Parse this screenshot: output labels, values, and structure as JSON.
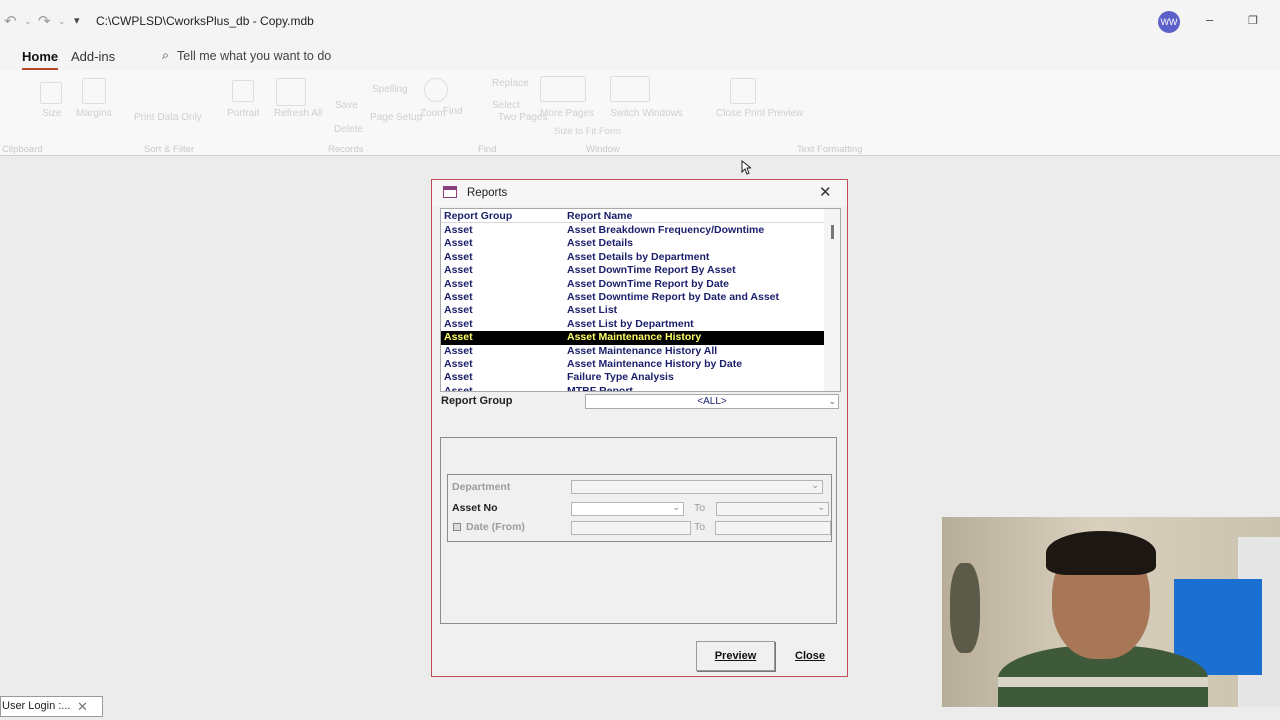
{
  "titlebar": {
    "path": "C:\\CWPLSD\\CworksPlus_db - Copy.mdb",
    "avatar_initials": "WW",
    "undo_icon": "undo-icon",
    "redo_icon": "redo-icon"
  },
  "tabs": {
    "home": "Home",
    "addins": "Add-ins",
    "tell_me": "Tell me what you want to do"
  },
  "ribbon": {
    "items": [
      "Size",
      "Margins",
      "Print Data Only",
      "Portrait",
      "Landscape",
      "Columns",
      "Page Setup",
      "Zoom",
      "One Page",
      "Two Pages",
      "More Pages",
      "Refresh All",
      "Save",
      "Delete",
      "Spelling",
      "Replace",
      "Select",
      "Find",
      "Size to Fit Form",
      "Switch Windows",
      "Close Print Preview",
      "Remove Sort",
      "Toggle",
      "Advanced",
      "Selection"
    ],
    "groups": [
      "Clipboard",
      "Sort & Filter",
      "Records",
      "Find",
      "Window",
      "Text Formatting"
    ]
  },
  "dialog": {
    "title": "Reports",
    "columns": [
      "Report Group",
      "Report Name"
    ],
    "rows": [
      {
        "group": "Asset",
        "name": "Asset Breakdown Frequency/Downtime"
      },
      {
        "group": "Asset",
        "name": "Asset Details"
      },
      {
        "group": "Asset",
        "name": "Asset Details by Department"
      },
      {
        "group": "Asset",
        "name": "Asset DownTime Report  By Asset"
      },
      {
        "group": "Asset",
        "name": "Asset DownTime Report by Date"
      },
      {
        "group": "Asset",
        "name": "Asset Downtime Report by Date and Asset"
      },
      {
        "group": "Asset",
        "name": "Asset List"
      },
      {
        "group": "Asset",
        "name": "Asset List by Department"
      },
      {
        "group": "Asset",
        "name": "Asset Maintenance History"
      },
      {
        "group": "Asset",
        "name": "Asset Maintenance History All"
      },
      {
        "group": "Asset",
        "name": "Asset Maintenance History by Date"
      },
      {
        "group": "Asset",
        "name": "Failure  Type Analysis"
      },
      {
        "group": "Asset",
        "name": "MTBF Report"
      }
    ],
    "selected_index": 8,
    "report_group_label": "Report Group",
    "report_group_value": "<ALL>",
    "department_label": "Department",
    "asset_no_label": "Asset No",
    "date_from_label": "Date (From)",
    "to_label": "To",
    "preview_label": "Preview",
    "close_label": "Close"
  },
  "status": {
    "text": "User Login :..."
  }
}
